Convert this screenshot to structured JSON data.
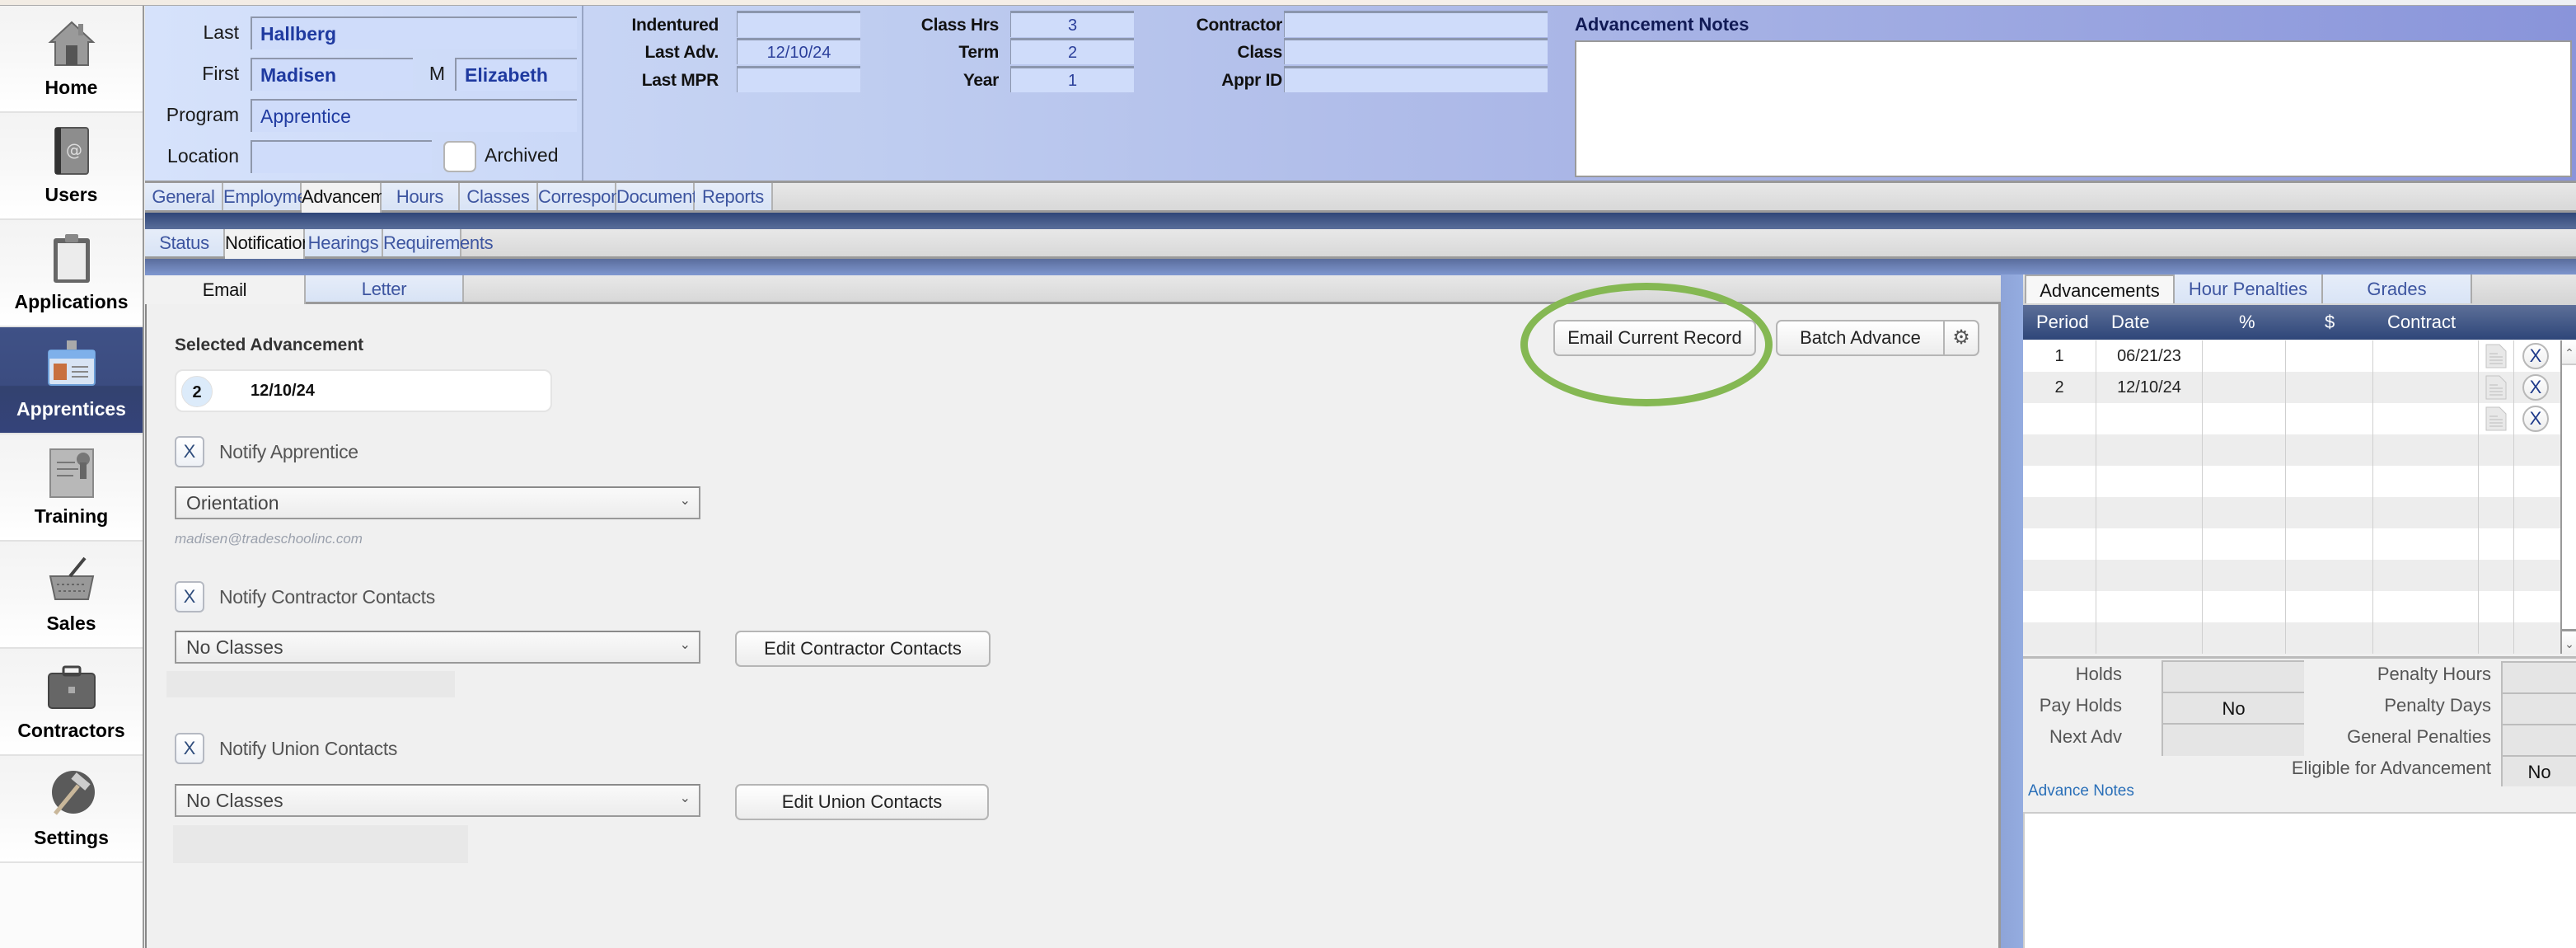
{
  "sidebar": {
    "items": [
      {
        "label": "Home",
        "icon": "home-icon",
        "active": false
      },
      {
        "label": "Users",
        "icon": "address-book-icon",
        "active": false
      },
      {
        "label": "Applications",
        "icon": "clipboard-icon",
        "active": false
      },
      {
        "label": "Apprentices",
        "icon": "id-badge-icon",
        "active": true
      },
      {
        "label": "Training",
        "icon": "certificate-icon",
        "active": false
      },
      {
        "label": "Sales",
        "icon": "basket-icon",
        "active": false
      },
      {
        "label": "Contractors",
        "icon": "briefcase-icon",
        "active": false
      },
      {
        "label": "Settings",
        "icon": "hammer-icon",
        "active": false
      }
    ]
  },
  "header": {
    "last_label": "Last",
    "last_value": "Hallberg",
    "first_label": "First",
    "first_value": "Madisen",
    "middle_label": "M",
    "middle_value": "Elizabeth",
    "program_label": "Program",
    "program_value": "Apprentice",
    "location_label": "Location",
    "location_value": "",
    "archived_label": "Archived",
    "archived_checked": false,
    "indentured_label": "Indentured",
    "indentured_value": "",
    "last_adv_label": "Last Adv.",
    "last_adv_value": "12/10/24",
    "last_mpr_label": "Last MPR",
    "last_mpr_value": "",
    "class_hrs_label": "Class Hrs",
    "class_hrs_value": "3",
    "term_label": "Term",
    "term_value": "2",
    "year_label": "Year",
    "year_value": "1",
    "contractor_label": "Contractor",
    "contractor_value": "",
    "class_label": "Class",
    "class_value": "",
    "appr_id_label": "Appr ID",
    "appr_id_value": "",
    "notes_title": "Advancement Notes",
    "notes_value": ""
  },
  "main_tabs": [
    {
      "label": "General",
      "active": false
    },
    {
      "label": "Employment",
      "active": false
    },
    {
      "label": "Advancements",
      "active": true
    },
    {
      "label": "Hours",
      "active": false
    },
    {
      "label": "Classes",
      "active": false
    },
    {
      "label": "Correspondence",
      "active": false
    },
    {
      "label": "Documents",
      "active": false
    },
    {
      "label": "Reports",
      "active": false
    }
  ],
  "sub_tabs": [
    {
      "label": "Status",
      "active": false
    },
    {
      "label": "Notifications",
      "active": true
    },
    {
      "label": "Hearings",
      "active": false
    },
    {
      "label": "Requirements",
      "active": false
    }
  ],
  "notif_tabs": [
    {
      "label": "Email",
      "active": true
    },
    {
      "label": "Letter",
      "active": false
    }
  ],
  "email_panel": {
    "selected_title": "Selected Advancement",
    "selected_period": "2",
    "selected_date": "12/10/24",
    "email_current_label": "Email Current Record",
    "batch_advance_label": "Batch Advance",
    "notify_apprentice": {
      "mark": "X",
      "label": "Notify Apprentice",
      "dropdown": "Orientation",
      "email": "madisen@tradeschoolinc.com"
    },
    "notify_contractor": {
      "mark": "X",
      "label": "Notify Contractor Contacts",
      "dropdown": "No Classes",
      "button": "Edit Contractor Contacts"
    },
    "notify_union": {
      "mark": "X",
      "label": "Notify Union Contacts",
      "dropdown": "No Classes",
      "button": "Edit Union Contacts"
    },
    "highlight_color": "#85b853"
  },
  "right_panel": {
    "tabs": [
      {
        "label": "Advancements",
        "active": true
      },
      {
        "label": "Hour Penalties",
        "active": false
      },
      {
        "label": "Grades",
        "active": false
      }
    ],
    "columns": [
      "Period",
      "Date",
      "%",
      "$",
      "Contract"
    ],
    "rows": [
      {
        "period": "1",
        "date": "06/21/23",
        "pct": "",
        "amount": "",
        "contract": ""
      },
      {
        "period": "2",
        "date": "12/10/24",
        "pct": "",
        "amount": "",
        "contract": ""
      },
      {
        "period": "",
        "date": "",
        "pct": "",
        "amount": "",
        "contract": ""
      }
    ],
    "delete_mark": "X",
    "stats": {
      "holds_label": "Holds",
      "holds_value": "",
      "pay_holds_label": "Pay Holds",
      "pay_holds_value": "No",
      "next_adv_label": "Next Adv",
      "next_adv_value": "",
      "penalty_hours_label": "Penalty Hours",
      "penalty_hours_value": "",
      "penalty_days_label": "Penalty Days",
      "penalty_days_value": "",
      "general_penalties_label": "General Penalties",
      "general_penalties_value": "",
      "eligible_label": "Eligible for Advancement",
      "eligible_value": "No"
    },
    "advance_notes_label": "Advance Notes"
  }
}
